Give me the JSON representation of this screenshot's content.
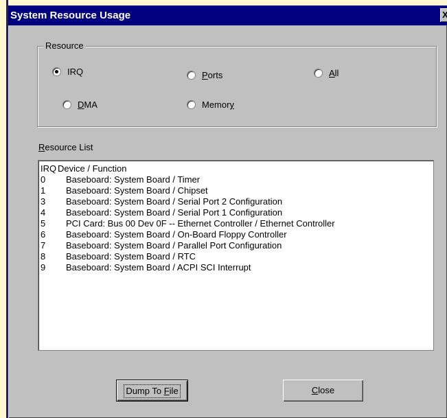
{
  "window": {
    "title": "System Resource Usage",
    "close_glyph": "X"
  },
  "resource_group": {
    "legend": "Resource",
    "options": [
      {
        "key": "irq",
        "pre": "",
        "access": "",
        "post": "IRQ",
        "label_full": "IRQ",
        "selected": true
      },
      {
        "key": "ports",
        "pre": "",
        "access": "P",
        "post": "orts",
        "label_full": "Ports",
        "selected": false
      },
      {
        "key": "all",
        "pre": "",
        "access": "A",
        "post": "ll",
        "label_full": "All",
        "selected": false
      },
      {
        "key": "dma",
        "pre": "",
        "access": "D",
        "post": "MA",
        "label_full": "DMA",
        "selected": false
      },
      {
        "key": "memory",
        "pre": "Memor",
        "access": "y",
        "post": "",
        "label_full": "Memory",
        "selected": false
      }
    ]
  },
  "resource_list": {
    "label_access": "R",
    "label_rest": "esource List",
    "header": {
      "irq": "IRQ",
      "device": "Device / Function"
    },
    "rows": [
      {
        "irq": "0",
        "device": "Baseboard:  System Board / Timer"
      },
      {
        "irq": "1",
        "device": "Baseboard:  System Board / Chipset"
      },
      {
        "irq": "3",
        "device": "Baseboard:  System Board / Serial Port 2 Configuration"
      },
      {
        "irq": "4",
        "device": "Baseboard:  System Board / Serial Port 1 Configuration"
      },
      {
        "irq": "5",
        "device": "PCI Card:   Bus 00 Dev 0F -- Ethernet Controller / Ethernet Controller"
      },
      {
        "irq": "6",
        "device": "Baseboard:  System Board / On-Board Floppy Controller"
      },
      {
        "irq": "7",
        "device": "Baseboard:  System Board / Parallel Port Configuration"
      },
      {
        "irq": "8",
        "device": "Baseboard:  System Board / RTC"
      },
      {
        "irq": "9",
        "device": "Baseboard:  System Board / ACPI SCI Interrupt"
      }
    ]
  },
  "buttons": {
    "dump_pre": "Dump To ",
    "dump_access": "F",
    "dump_post": "ile",
    "close_access": "C",
    "close_post": "lose"
  }
}
